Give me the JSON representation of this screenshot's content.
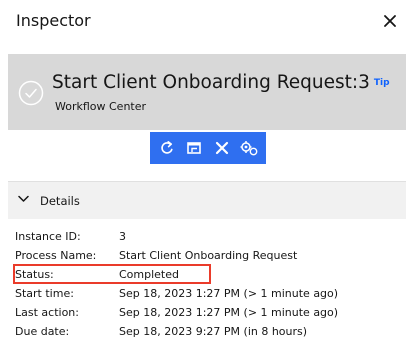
{
  "window": {
    "title": "Inspector"
  },
  "header": {
    "title": "Start Client Onboarding Request:3",
    "tip_label": "Tip",
    "subtitle": "Workflow Center",
    "bg_color": "#d8d8d8"
  },
  "toolbar": {
    "accent_color": "#2f6ff0",
    "buttons": [
      {
        "icon": "refresh-icon"
      },
      {
        "icon": "open-window-icon"
      },
      {
        "icon": "close-icon"
      },
      {
        "icon": "settings-icon"
      }
    ]
  },
  "details": {
    "section_label": "Details",
    "rows": [
      {
        "label": "Instance ID:",
        "value": "3"
      },
      {
        "label": "Process Name:",
        "value": "Start Client Onboarding Request"
      },
      {
        "label": "Status:",
        "value": "Completed"
      },
      {
        "label": "Start time:",
        "value": "Sep 18, 2023 1:27 PM (> 1 minute ago)"
      },
      {
        "label": "Last action:",
        "value": "Sep 18, 2023 1:27 PM (> 1 minute ago)"
      },
      {
        "label": "Due date:",
        "value": "Sep 18, 2023 9:27 PM (in 8 hours)"
      }
    ]
  },
  "highlight_color": "#ea3b2a"
}
